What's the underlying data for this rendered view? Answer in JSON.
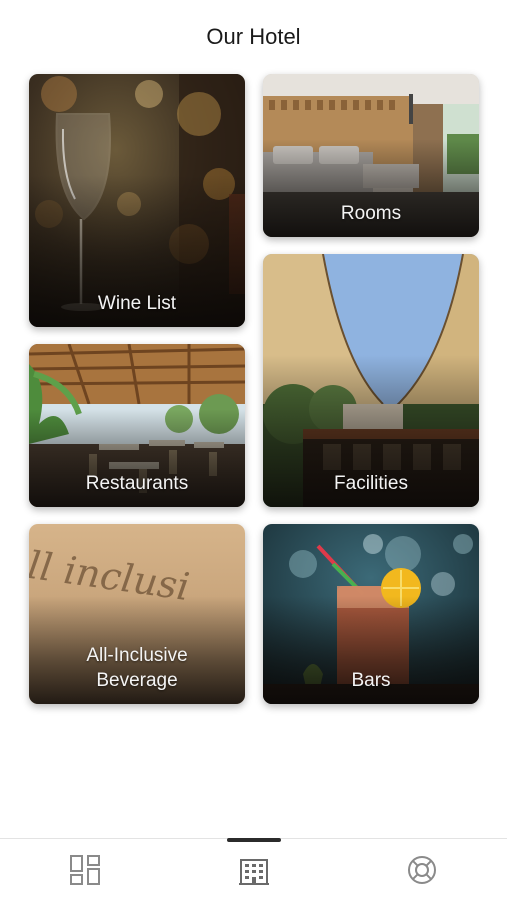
{
  "header": {
    "title": "Our Hotel"
  },
  "tiles": [
    {
      "id": "wine-list",
      "label": "Wine List"
    },
    {
      "id": "rooms",
      "label": "Rooms"
    },
    {
      "id": "restaurants",
      "label": "Restaurants"
    },
    {
      "id": "facilities",
      "label": "Facilities"
    },
    {
      "id": "all-inclusive-beverage",
      "label": "All-Inclusive\nBeverage"
    },
    {
      "id": "bars",
      "label": "Bars"
    }
  ],
  "bottom_nav": {
    "items": [
      {
        "icon": "dashboard-icon",
        "active": false
      },
      {
        "icon": "hotel-building-icon",
        "active": true
      },
      {
        "icon": "lifebuoy-icon",
        "active": false
      }
    ],
    "active_color": "#2b2b2b",
    "icon_color": "#8a8a8a"
  },
  "decor": {
    "tile_text": "ll inclusi"
  }
}
